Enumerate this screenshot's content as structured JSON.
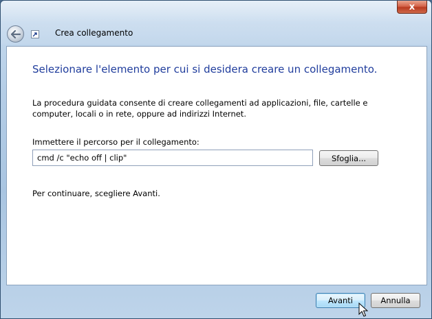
{
  "window": {
    "close_glyph": "x",
    "title": "Crea collegamento"
  },
  "page": {
    "heading": "Selezionare l'elemento per cui si desidera creare un collegamento.",
    "description": "La procedura guidata consente di creare collegamenti ad applicazioni, file, cartelle e computer, locali o in rete, oppure ad indirizzi Internet.",
    "path_label": "Immettere il percorso per il collegamento:",
    "path_value": "cmd /c \"echo off | clip\"",
    "browse_label": "Sfoglia...",
    "continue_hint": "Per continuare, scegliere Avanti."
  },
  "footer": {
    "next_label": "Avanti",
    "cancel_label": "Annulla"
  },
  "icons": {
    "back": "back-arrow-icon",
    "shortcut": "shortcut-arrow-icon",
    "close": "close-icon"
  },
  "colors": {
    "heading": "#1f3c9c",
    "close_button": "#c9503a",
    "default_button_border": "#3c7fb1"
  }
}
